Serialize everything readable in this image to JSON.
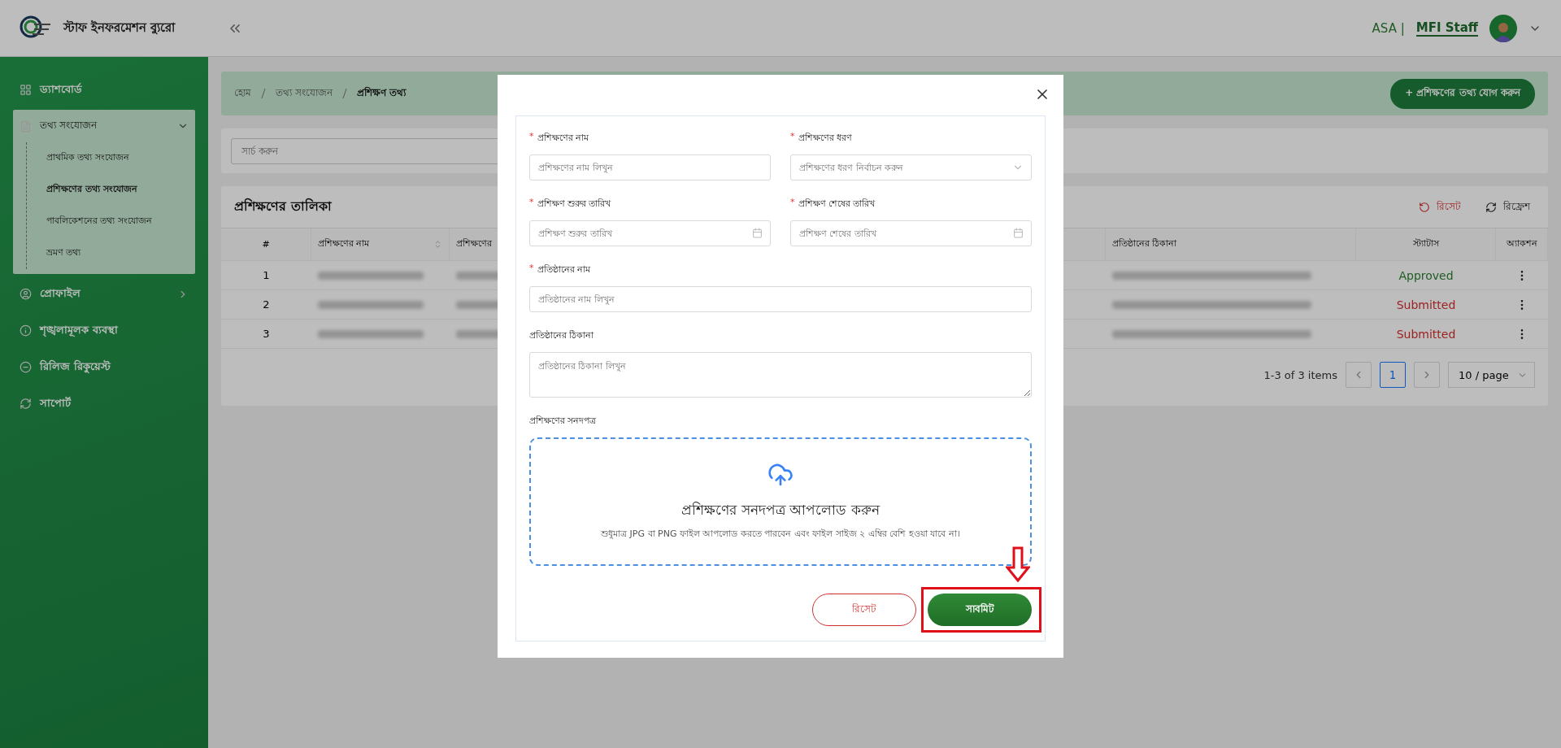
{
  "header": {
    "app_title": "স্টাফ ইনফরমেশন ব্যুরো",
    "org": "ASA |",
    "role": "MFI Staff"
  },
  "sidebar": {
    "items": [
      {
        "kind": "link",
        "label": "ড্যাশবোর্ড"
      },
      {
        "kind": "group",
        "label": "তথ্য সংযোজন",
        "expanded": true,
        "children": [
          {
            "label": "প্রাথমিক তথ্য সংযোজন",
            "selected": false
          },
          {
            "label": "প্রশিক্ষণের তথ্য সংযোজন",
            "selected": true
          },
          {
            "label": "পাবলিকেশনের তথ্য সংযোজন",
            "selected": false
          },
          {
            "label": "ভ্রমণ তথ্য",
            "selected": false
          }
        ]
      },
      {
        "kind": "group",
        "label": "প্রোফাইল",
        "expanded": false
      },
      {
        "kind": "link",
        "label": "শৃঙ্খলামূলক ব্যবস্থা"
      },
      {
        "kind": "link",
        "label": "রিলিজ রিকুয়েস্ট"
      },
      {
        "kind": "link",
        "label": "সাপোর্ট"
      }
    ]
  },
  "breadcrumb": [
    "হোম",
    "তথ্য সংযোজন",
    "প্রশিক্ষণ তথ্য"
  ],
  "add_button": "+ প্রশিক্ষণের তথ্য যোগ করুন",
  "search": {
    "placeholder": "সার্চ করুন"
  },
  "table": {
    "title": "প্রশিক্ষণের তালিকা",
    "reset": "রিসেট",
    "refresh": "রিফ্রেশ",
    "columns": [
      "#",
      "প্রশিক্ষণের নাম",
      "প্রশিক্ষণের",
      "প্রতিষ্ঠানের ঠিকানা",
      "স্ট্যাটাস",
      "অ্যাকশন"
    ],
    "rows": [
      {
        "index": "1",
        "status": "Approved",
        "kind": "approved"
      },
      {
        "index": "2",
        "status": "Submitted",
        "kind": "submitted"
      },
      {
        "index": "3",
        "status": "Submitted",
        "kind": "submitted"
      }
    ],
    "summary": "1-3 of 3 items",
    "pages": [
      {
        "label": "1",
        "selected": true
      }
    ],
    "page_size": "10 / page"
  },
  "modal": {
    "fields": [
      {
        "kind": "input",
        "marker": "*",
        "label": "প্রশিক্ষণের নাম",
        "placeholder": "প্রশিক্ষণের নাম লিখুন"
      },
      {
        "kind": "select",
        "marker": "*",
        "label": "প্রশিক্ষণের ধরণ",
        "placeholder": "প্রশিক্ষণের ধরণ নির্বাচন করুন"
      },
      {
        "kind": "date",
        "marker": "*",
        "label": "প্রশিক্ষণ শুরুর তারিখ",
        "placeholder": "প্রশিক্ষণ শুরুর তারিখ"
      },
      {
        "kind": "date",
        "marker": "*",
        "label": "প্রশিক্ষণ শেষের তারিখ",
        "placeholder": "প্রশিক্ষণ শেষের তারিখ"
      },
      {
        "kind": "wide",
        "marker": "*",
        "label": "প্রতিষ্ঠানের নাম",
        "placeholder": "প্রতিষ্ঠানের নাম লিখুন"
      },
      {
        "kind": "textarea",
        "label": "প্রতিষ্ঠানের ঠিকানা",
        "placeholder": "প্রতিষ্ঠানের ঠিকানা লিখুন"
      }
    ],
    "upload": {
      "label": "প্রশিক্ষণের সনদপত্র",
      "title": "প্রশিক্ষণের সনদপত্র আপলোড করুন",
      "hint": "শুধুমাত্র JPG বা PNG ফাইল আপলোড করতে পারবেন এবং ফাইল সাইজ ২ এম্বির বেশি হওয়া যাবে না।"
    },
    "reset_button": "রিসেট",
    "submit_button": "সাবমিট",
    "submit_highlighted": true
  }
}
